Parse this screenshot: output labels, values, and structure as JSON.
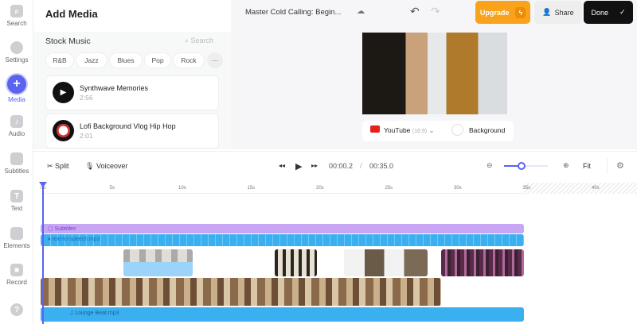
{
  "sidebar": {
    "items": [
      {
        "label": "Search",
        "icon": "search-icon"
      },
      {
        "label": "Settings",
        "icon": "gear-icon"
      },
      {
        "label": "Media",
        "icon": "plus-icon",
        "active": true
      },
      {
        "label": "Audio",
        "icon": "music-note-icon"
      },
      {
        "label": "Subtitles",
        "icon": "subtitles-icon"
      },
      {
        "label": "Text",
        "icon": "text-icon"
      },
      {
        "label": "Elements",
        "icon": "elements-icon"
      },
      {
        "label": "Record",
        "icon": "record-icon"
      },
      {
        "label": "?",
        "icon": "help-icon"
      }
    ]
  },
  "panel": {
    "title": "Add Media",
    "section": "Stock Music",
    "search_placeholder": "Search",
    "genres": [
      "R&B",
      "Jazz",
      "Blues",
      "Pop",
      "Rock"
    ],
    "more": "···",
    "tracks": [
      {
        "title": "Synthwave Memories",
        "duration": "2:56"
      },
      {
        "title": "Lofi Background Vlog Hip Hop",
        "duration": "2:01"
      }
    ]
  },
  "header": {
    "project_title": "Master Cold Calling: Begin...",
    "upgrade": "Upgrade",
    "share": "Share",
    "done": "Done"
  },
  "preview": {
    "format": "YouTube",
    "ratio": "(16:9)",
    "background": "Background"
  },
  "toolbar": {
    "split": "Split",
    "voiceover": "Voiceover",
    "current_time": "00:00.2",
    "separator": "/",
    "total_time": "00:35.0",
    "fit": "Fit",
    "zoom_level": 0.4
  },
  "ruler": [
    "0s",
    "5s",
    "10s",
    "15s",
    "20s",
    "25s",
    "30s",
    "35s",
    "40s"
  ],
  "tracks": {
    "subtitles": "Subtitles",
    "speech": "text-to-speech.mp3",
    "music": "Lounge Beat.mp3"
  },
  "colors": {
    "accent": "#5b63f0",
    "upgrade": "#f9a21b",
    "subtitles": "#c9a6f5",
    "audio": "#3bb0f0"
  }
}
